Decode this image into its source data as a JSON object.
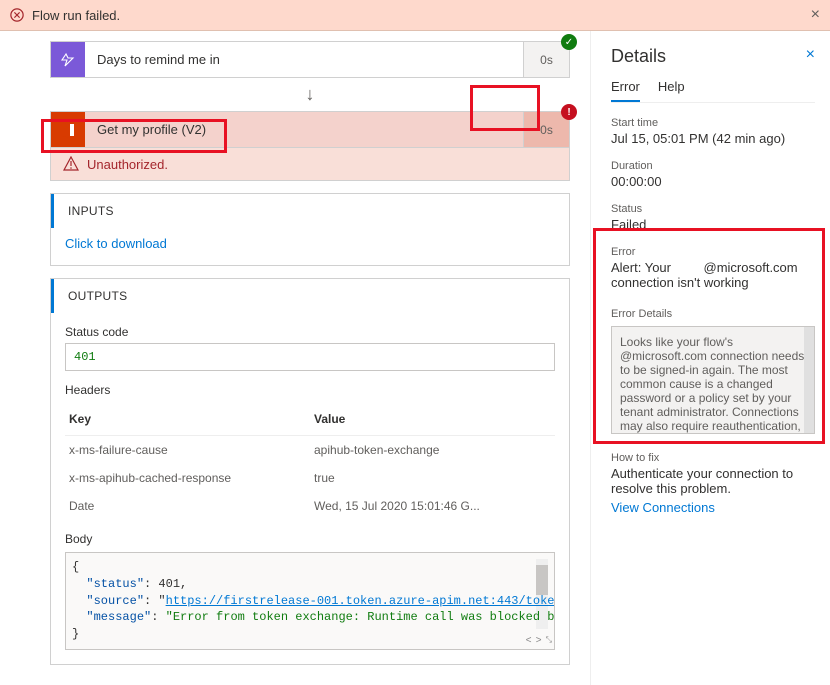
{
  "notification": {
    "text": "Flow run failed."
  },
  "step_days": {
    "title": "Days to remind me in",
    "time": "0s"
  },
  "step_profile": {
    "title": "Get my profile (V2)",
    "time": "0s",
    "error": "Unauthorized."
  },
  "inputs": {
    "header": "INPUTS",
    "download": "Click to download"
  },
  "outputs": {
    "header": "OUTPUTS",
    "status_label": "Status code",
    "status_value": "401",
    "headers_label": "Headers",
    "header_key": "Key",
    "header_value": "Value",
    "rows": [
      {
        "k": "x-ms-failure-cause",
        "v": "apihub-token-exchange"
      },
      {
        "k": "x-ms-apihub-cached-response",
        "v": "true"
      },
      {
        "k": "Date",
        "v": "Wed, 15 Jul 2020 15:01:46 G..."
      }
    ],
    "body_label": "Body",
    "json": {
      "status": "401",
      "source_url": "https://firstrelease-001.token.azure-apim.net:443/toke",
      "message": "Error from token exchange: Runtime call was blocked b"
    }
  },
  "details": {
    "title": "Details",
    "tab_error": "Error",
    "tab_help": "Help",
    "start_label": "Start time",
    "start_value": "Jul 15, 05:01 PM (42 min ago)",
    "duration_label": "Duration",
    "duration_value": "00:00:00",
    "status_label": "Status",
    "status_value": "Failed",
    "error_label": "Error",
    "error_value1": "Alert: Your",
    "error_value2": "@microsoft.com",
    "error_value3": "connection isn't working",
    "errdet_label": "Error Details",
    "errdet_value": "Looks like your flow's                  @microsoft.com connection needs to be signed-in again. The most common cause is a changed password or a policy set by your tenant administrator. Connections may also require reauthentication, if multi-factor authentication has been recently",
    "fix_label": "How to fix",
    "fix_value": "Authenticate your connection to resolve this problem.",
    "view_conn": "View Connections"
  }
}
